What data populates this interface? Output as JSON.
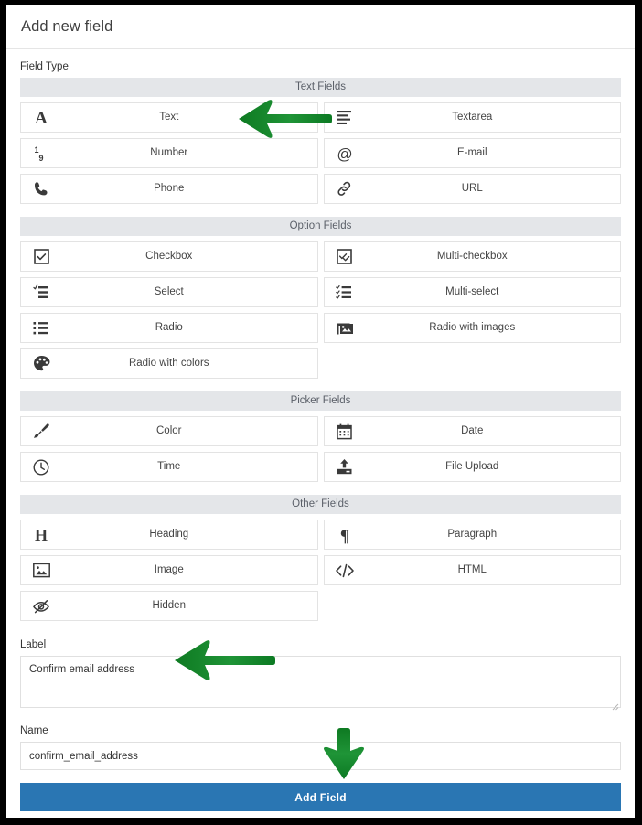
{
  "modal": {
    "title": "Add new field"
  },
  "field_type": {
    "label": "Field Type",
    "sections": [
      {
        "title": "Text Fields",
        "items": [
          {
            "label": "Text",
            "icon": "letter-a-icon"
          },
          {
            "label": "Textarea",
            "icon": "text-lines-icon"
          },
          {
            "label": "Number",
            "icon": "one-nine-digits-icon"
          },
          {
            "label": "E-mail",
            "icon": "at-sign-icon"
          },
          {
            "label": "Phone",
            "icon": "phone-handset-icon"
          },
          {
            "label": "URL",
            "icon": "chain-link-icon"
          }
        ]
      },
      {
        "title": "Option Fields",
        "items": [
          {
            "label": "Checkbox",
            "icon": "checkbox-checked-icon"
          },
          {
            "label": "Multi-checkbox",
            "icon": "multi-checkbox-icon"
          },
          {
            "label": "Select",
            "icon": "select-list-icon"
          },
          {
            "label": "Multi-select",
            "icon": "multi-select-list-icon"
          },
          {
            "label": "Radio",
            "icon": "bullet-list-icon"
          },
          {
            "label": "Radio with images",
            "icon": "images-stack-icon"
          },
          {
            "label": "Radio with colors",
            "icon": "color-palette-icon"
          }
        ]
      },
      {
        "title": "Picker Fields",
        "items": [
          {
            "label": "Color",
            "icon": "paint-brush-icon"
          },
          {
            "label": "Date",
            "icon": "calendar-icon"
          },
          {
            "label": "Time",
            "icon": "clock-icon"
          },
          {
            "label": "File Upload",
            "icon": "upload-tray-icon"
          }
        ]
      },
      {
        "title": "Other Fields",
        "items": [
          {
            "label": "Heading",
            "icon": "letter-h-icon"
          },
          {
            "label": "Paragraph",
            "icon": "pilcrow-icon"
          },
          {
            "label": "Image",
            "icon": "picture-icon"
          },
          {
            "label": "HTML",
            "icon": "code-tags-icon"
          },
          {
            "label": "Hidden",
            "icon": "eye-slash-icon"
          }
        ]
      }
    ]
  },
  "label_field": {
    "label": "Label",
    "value": "Confirm email address"
  },
  "name_field": {
    "label": "Name",
    "value": "confirm_email_address"
  },
  "submit": {
    "label": "Add Field"
  },
  "annotations": {
    "arrow_color": "#198c33",
    "arrows": [
      {
        "name": "arrow-pointing-to-text-field-type",
        "direction": "left"
      },
      {
        "name": "arrow-pointing-to-label-input",
        "direction": "left"
      },
      {
        "name": "arrow-pointing-to-add-field-button",
        "direction": "down"
      }
    ]
  },
  "colors": {
    "primary_button": "#2a76b3",
    "section_bar": "#e4e6e9",
    "border": "#e3e3e3"
  }
}
